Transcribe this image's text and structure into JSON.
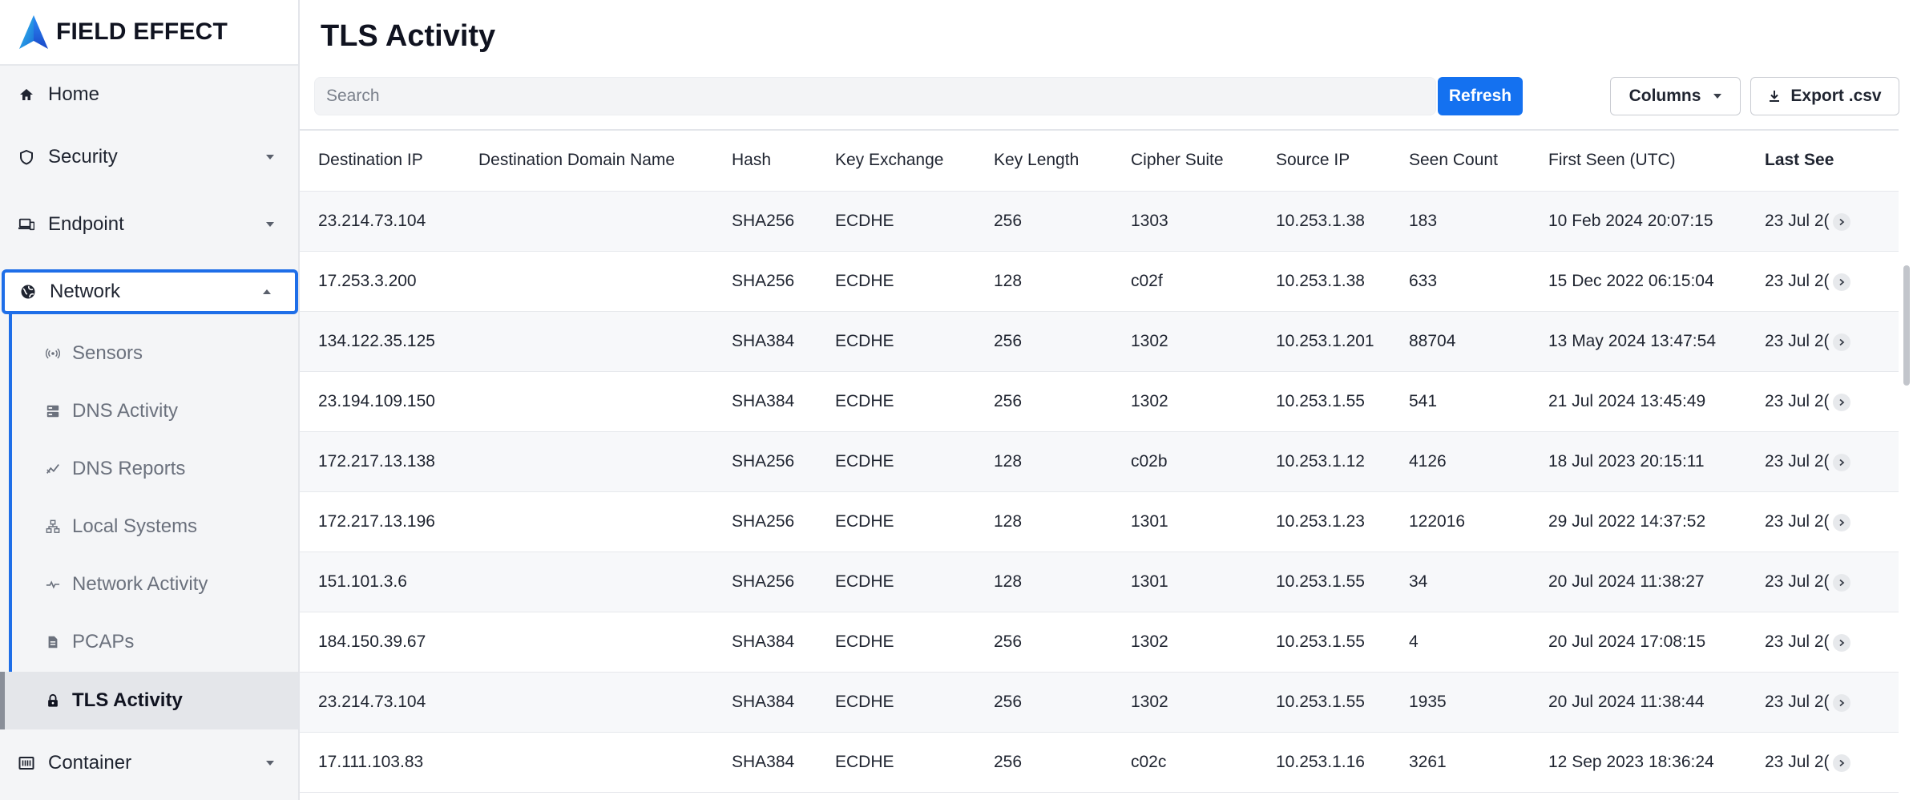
{
  "brand": {
    "name": "FIELD EFFECT"
  },
  "sidebar": {
    "home": "Home",
    "security": "Security",
    "endpoint": "Endpoint",
    "network": "Network",
    "network_items": [
      "Sensors",
      "DNS Activity",
      "DNS Reports",
      "Local Systems",
      "Network Activity",
      "PCAPs",
      "TLS Activity"
    ],
    "container": "Container"
  },
  "page": {
    "title": "TLS Activity"
  },
  "toolbar": {
    "search_placeholder": "Search",
    "refresh": "Refresh",
    "columns": "Columns",
    "export": "Export .csv"
  },
  "table": {
    "headers": [
      "Destination IP",
      "Destination Domain Name",
      "Hash",
      "Key Exchange",
      "Key Length",
      "Cipher Suite",
      "Source IP",
      "Seen Count",
      "First Seen (UTC)",
      "Last See"
    ],
    "rows": [
      [
        "23.214.73.104",
        "",
        "SHA256",
        "ECDHE",
        "256",
        "1303",
        "10.253.1.38",
        "183",
        "10 Feb 2024 20:07:15",
        "23 Jul 2("
      ],
      [
        "17.253.3.200",
        "",
        "SHA256",
        "ECDHE",
        "128",
        "c02f",
        "10.253.1.38",
        "633",
        "15 Dec 2022 06:15:04",
        "23 Jul 2("
      ],
      [
        "134.122.35.125",
        "",
        "SHA384",
        "ECDHE",
        "256",
        "1302",
        "10.253.1.201",
        "88704",
        "13 May 2024 13:47:54",
        "23 Jul 2("
      ],
      [
        "23.194.109.150",
        "",
        "SHA384",
        "ECDHE",
        "256",
        "1302",
        "10.253.1.55",
        "541",
        "21 Jul 2024 13:45:49",
        "23 Jul 2("
      ],
      [
        "172.217.13.138",
        "",
        "SHA256",
        "ECDHE",
        "128",
        "c02b",
        "10.253.1.12",
        "4126",
        "18 Jul 2023 20:15:11",
        "23 Jul 2("
      ],
      [
        "172.217.13.196",
        "",
        "SHA256",
        "ECDHE",
        "128",
        "1301",
        "10.253.1.23",
        "122016",
        "29 Jul 2022 14:37:52",
        "23 Jul 2("
      ],
      [
        "151.101.3.6",
        "",
        "SHA256",
        "ECDHE",
        "128",
        "1301",
        "10.253.1.55",
        "34",
        "20 Jul 2024 11:38:27",
        "23 Jul 2("
      ],
      [
        "184.150.39.67",
        "",
        "SHA384",
        "ECDHE",
        "256",
        "1302",
        "10.253.1.55",
        "4",
        "20 Jul 2024 17:08:15",
        "23 Jul 2("
      ],
      [
        "23.214.73.104",
        "",
        "SHA384",
        "ECDHE",
        "256",
        "1302",
        "10.253.1.55",
        "1935",
        "20 Jul 2024 11:38:44",
        "23 Jul 2("
      ],
      [
        "17.111.103.83",
        "",
        "SHA384",
        "ECDHE",
        "256",
        "c02c",
        "10.253.1.16",
        "3261",
        "12 Sep 2023 18:36:24",
        "23 Jul 2("
      ]
    ]
  },
  "colors": {
    "accent": "#1471f0",
    "highlight": "#1e6ee8"
  },
  "icons": {
    "home": "home-icon",
    "security": "shield-icon",
    "endpoint": "devices-icon",
    "network": "globe-icon",
    "sensors": "broadcast-icon",
    "dns_activity": "server-icon",
    "dns_reports": "chart-line-icon",
    "local_systems": "sitemap-icon",
    "network_activity": "activity-icon",
    "pcaps": "file-stack-icon",
    "tls_activity": "lock-icon",
    "container": "container-icon",
    "export": "download-icon",
    "row": "chevron-right-icon"
  }
}
